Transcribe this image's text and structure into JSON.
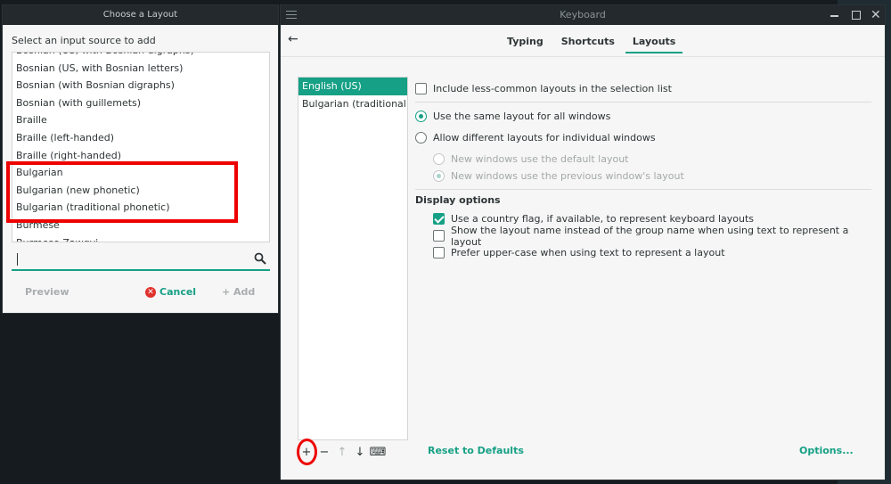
{
  "keyboard_window": {
    "title": "Keyboard",
    "tabs": [
      {
        "label": "Typing"
      },
      {
        "label": "Shortcuts"
      },
      {
        "label": "Layouts"
      }
    ],
    "active_tab": "Layouts",
    "layouts": [
      {
        "label": "English (US)",
        "selected": true
      },
      {
        "label": "Bulgarian (traditional phonetic)",
        "selected": false
      }
    ],
    "include_less_common": {
      "label": "Include less-common layouts in the selection list",
      "checked": false
    },
    "same_layout": {
      "label": "Use the same layout for all windows",
      "checked": true
    },
    "different_layouts": {
      "label": "Allow different layouts for individual windows",
      "checked": false
    },
    "new_default": {
      "label": "New windows use the default layout"
    },
    "new_previous": {
      "label": "New windows use the previous window's layout"
    },
    "display_options": {
      "title": "Display options",
      "country_flag": {
        "label": "Use a country flag, if available,  to represent keyboard layouts",
        "checked": true
      },
      "layout_name": {
        "label": "Show the layout name instead of the group name when using text to represent a layout",
        "checked": false
      },
      "upper_case": {
        "label": "Prefer upper-case when using text to represent a layout",
        "checked": false
      }
    },
    "toolbar": {
      "add": "+",
      "remove": "−",
      "up": "↑",
      "down": "↓",
      "keyboard": "⌨"
    },
    "reset_label": "Reset to Defaults",
    "options_label": "Options..."
  },
  "choose_dialog": {
    "title": "Choose a Layout",
    "prompt": "Select an input source to add",
    "items": [
      "Bosnian (US, with Bosnian digraphs)",
      "Bosnian (US, with Bosnian letters)",
      "Bosnian (with Bosnian digraphs)",
      "Bosnian (with guillemets)",
      "Braille",
      "Braille (left-handed)",
      "Braille (right-handed)",
      "Bulgarian",
      "Bulgarian (new phonetic)",
      "Bulgarian (traditional phonetic)",
      "Burmese",
      "Burmese Zawgyi"
    ],
    "search": {
      "value": "",
      "placeholder": ""
    },
    "preview_label": "Preview",
    "cancel_label": "Cancel",
    "add_label": "+ Add"
  },
  "colors": {
    "accent": "#16a085",
    "highlight": "#ee0000",
    "titlebar": "#23292d"
  }
}
